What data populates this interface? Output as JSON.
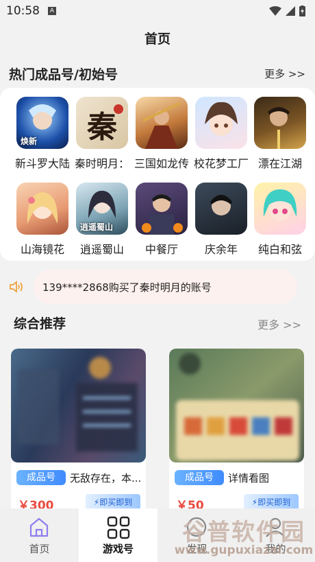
{
  "status": {
    "time": "10:58",
    "indicator": "A"
  },
  "header": {
    "title": "首页"
  },
  "hot": {
    "title": "热门成品号/初始号",
    "more": "更多 >>"
  },
  "games": [
    {
      "name": "新斗罗大陆",
      "icon": "game-icon",
      "tag": "焕新"
    },
    {
      "name": "秦时明月：",
      "icon": "game-icon",
      "char": "秦"
    },
    {
      "name": "三国如龙传",
      "icon": "game-icon"
    },
    {
      "name": "校花梦工厂",
      "icon": "game-icon"
    },
    {
      "name": "漂在江湖",
      "icon": "game-icon"
    },
    {
      "name": "山海镜花",
      "icon": "game-icon"
    },
    {
      "name": "逍遥蜀山",
      "icon": "game-icon",
      "tag": "逍遥蜀山"
    },
    {
      "name": "中餐厅",
      "icon": "game-icon"
    },
    {
      "name": "庆余年",
      "icon": "game-icon"
    },
    {
      "name": "纯白和弦",
      "icon": "game-icon"
    }
  ],
  "notice": {
    "text": "139****2868购买了秦时明月的账号"
  },
  "recommend": {
    "title": "综合推荐",
    "more": "更多 >>"
  },
  "products": [
    {
      "badge": "成品号",
      "desc": "无敌存在，本...",
      "price": "￥300",
      "buy": "即买即到"
    },
    {
      "badge": "成品号",
      "desc": "详情看图",
      "price": "￥50",
      "buy": "即买即到"
    }
  ],
  "tabs": [
    {
      "label": "首页",
      "icon": "home-icon",
      "active": false
    },
    {
      "label": "游戏号",
      "icon": "grid-icon",
      "active": true
    },
    {
      "label": "发现",
      "icon": "discover-icon",
      "active": false
    },
    {
      "label": "我的",
      "icon": "user-icon",
      "active": false
    }
  ],
  "watermark": {
    "line1": "谷普软件园",
    "line2": "www.gupuxiazai.com"
  },
  "colors": {
    "accent": "#3f8bfd",
    "price": "#e84a3f",
    "notice_bg": "#fdf1ef"
  }
}
